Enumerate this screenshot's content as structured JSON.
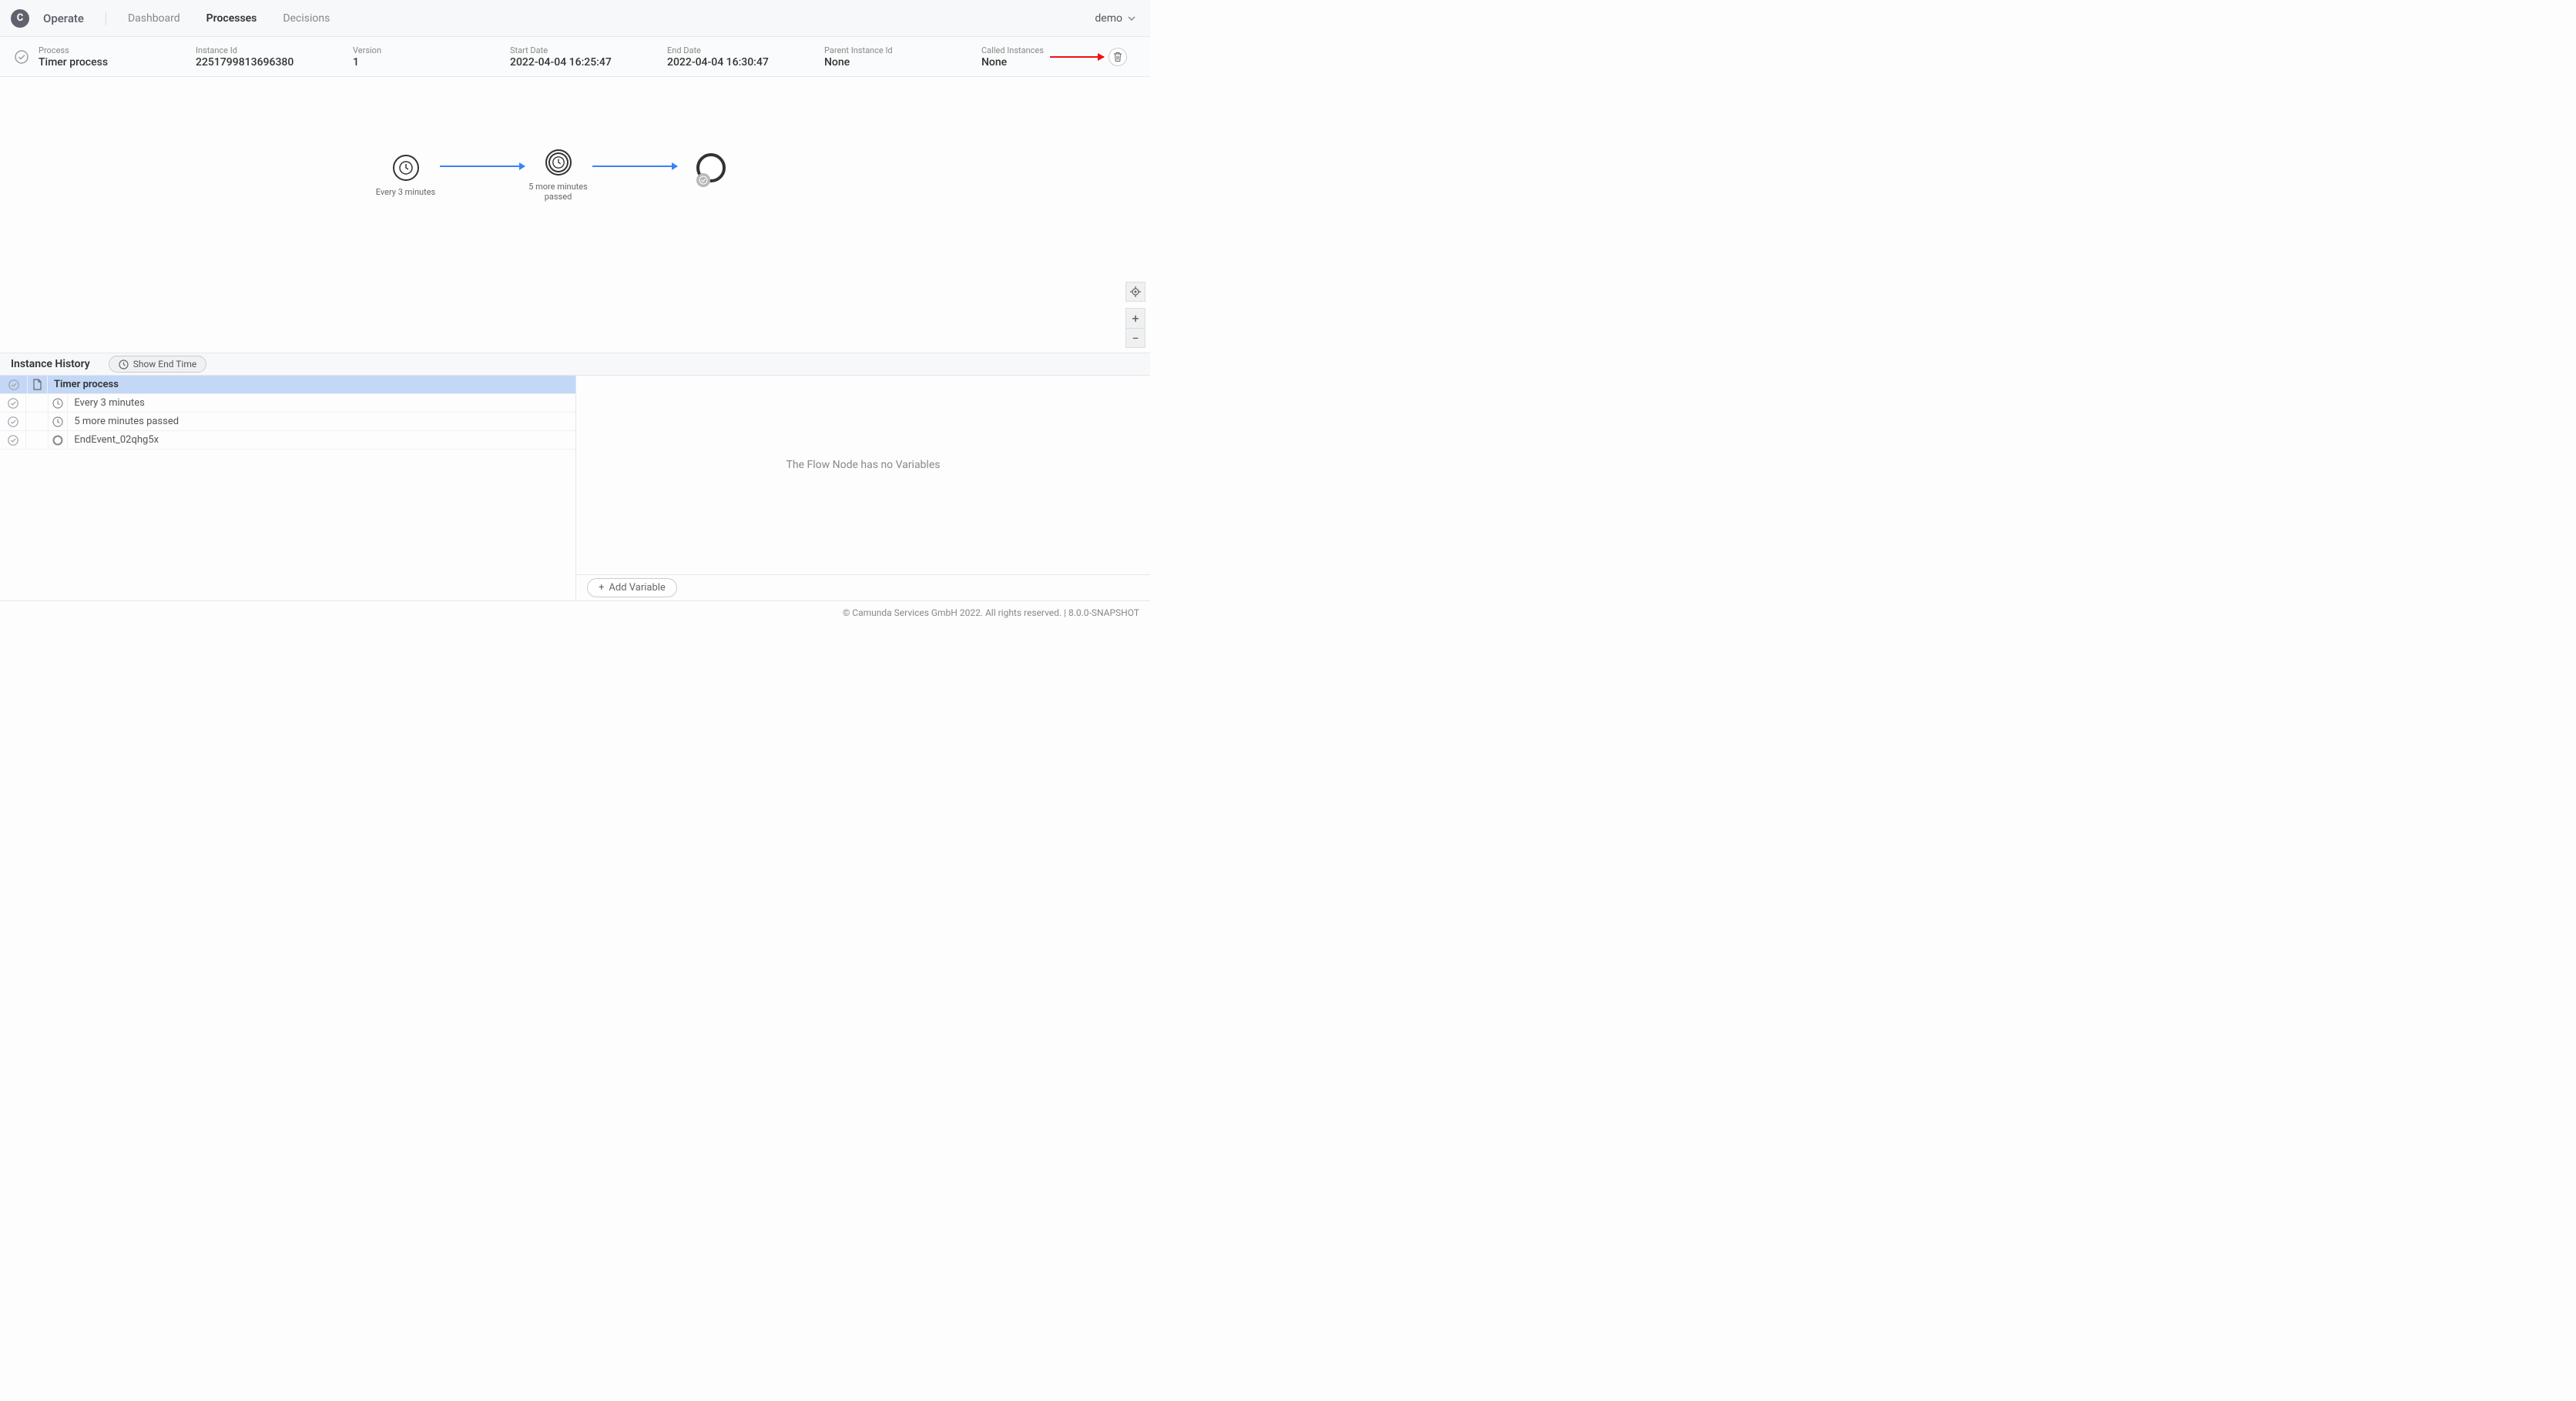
{
  "header": {
    "logo_letter": "C",
    "app_name": "Operate",
    "tabs": [
      {
        "label": "Dashboard",
        "active": false
      },
      {
        "label": "Processes",
        "active": true
      },
      {
        "label": "Decisions",
        "active": false
      }
    ],
    "user_label": "demo"
  },
  "details": {
    "process": {
      "label": "Process",
      "value": "Timer process"
    },
    "instance_id": {
      "label": "Instance Id",
      "value": "2251799813696380"
    },
    "version": {
      "label": "Version",
      "value": "1"
    },
    "start_date": {
      "label": "Start Date",
      "value": "2022-04-04 16:25:47"
    },
    "end_date": {
      "label": "End Date",
      "value": "2022-04-04 16:30:47"
    },
    "parent_instance": {
      "label": "Parent Instance Id",
      "value": "None"
    },
    "called_instances": {
      "label": "Called Instances",
      "value": "None"
    }
  },
  "diagram": {
    "start_label": "Every 3 minutes",
    "intermediate_label": "5 more minutes passed"
  },
  "history": {
    "title": "Instance History",
    "show_end_time_label": "Show End Time",
    "rows": [
      {
        "label": "Timer process",
        "type": "process",
        "selected": true
      },
      {
        "label": "Every 3 minutes",
        "type": "timer",
        "selected": false
      },
      {
        "label": "5 more minutes passed",
        "type": "timer",
        "selected": false
      },
      {
        "label": "EndEvent_02qhg5x",
        "type": "end",
        "selected": false
      }
    ]
  },
  "variables": {
    "empty_message": "The Flow Node has no Variables",
    "add_button_label": "Add Variable"
  },
  "footer": {
    "text": "© Camunda Services GmbH 2022. All rights reserved. | 8.0.0-SNAPSHOT"
  }
}
